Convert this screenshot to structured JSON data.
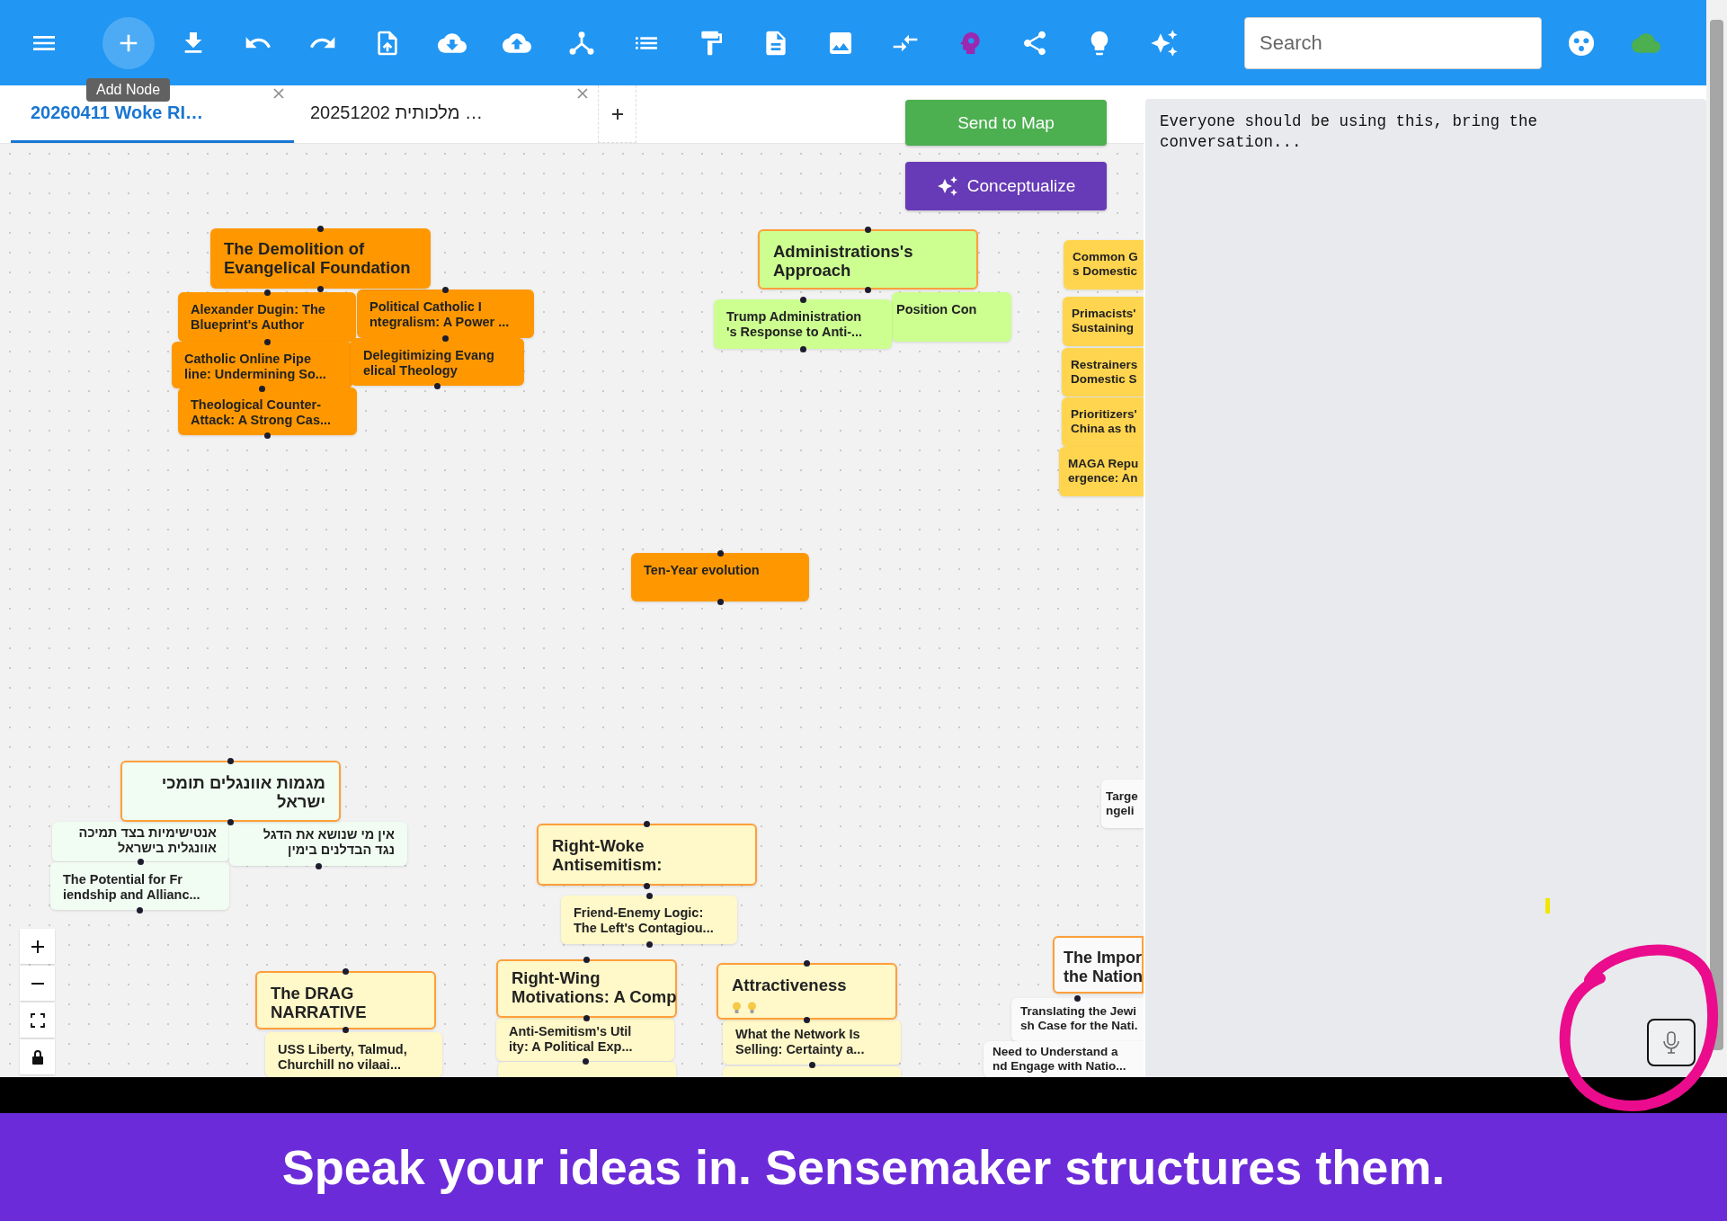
{
  "toolbar": {
    "tooltip": "Add Node",
    "search": {
      "placeholder": "Search"
    }
  },
  "tabs": [
    {
      "label": "20260411 Woke RI…",
      "selected": true
    },
    {
      "label": "20251202 מלכותית …",
      "selected": false
    }
  ],
  "actions": [
    {
      "label": "Send to Map",
      "kind": "send"
    },
    {
      "label": "Conceptualize",
      "kind": "conceptualize"
    }
  ],
  "nodes": [
    {
      "label": "The Demolition of\nEvangelical Foundation",
      "kind": "heading",
      "color": "#ff9800",
      "outlined": false
    },
    {
      "label": "Alexander Dugin: The\nBlueprint's Author",
      "kind": "item",
      "color": "#ff9800",
      "outlined": false
    },
    {
      "label": "Political Catholic I\nntegralism: A Power ...",
      "kind": "item",
      "color": "#ff9800",
      "outlined": false
    },
    {
      "label": "Catholic Online Pipe\nline: Undermining So...",
      "kind": "item",
      "color": "#ff9800",
      "outlined": false
    },
    {
      "label": "Delegitimizing Evang\nelical Theology",
      "kind": "item",
      "color": "#ff9800",
      "outlined": false
    },
    {
      "label": "Theological Counter-\nAttack: A Strong Cas...",
      "kind": "item",
      "color": "#ff9800",
      "outlined": false
    },
    {
      "label": "Administrations's\nApproach",
      "kind": "heading",
      "color": "#ccff90",
      "outlined": true
    },
    {
      "label": "Trump Administration\n's Response to Anti-...",
      "kind": "item",
      "color": "#ccff90",
      "outlined": false
    },
    {
      "label": "Position Con",
      "kind": "item",
      "color": "#ccff90",
      "outlined": false
    },
    {
      "label": "Common G\ns Domestic",
      "kind": "item",
      "color": "#ffd54f",
      "outlined": false
    },
    {
      "label": "Primacists'\nSustaining",
      "kind": "item",
      "color": "#ffd54f",
      "outlined": false
    },
    {
      "label": "Restrainers\nDomestic S",
      "kind": "item",
      "color": "#ffd54f",
      "outlined": false
    },
    {
      "label": "Prioritizers'\nChina as th",
      "kind": "item",
      "color": "#ffd54f",
      "outlined": false
    },
    {
      "label": "MAGA Repu\nergence: An",
      "kind": "item",
      "color": "#ffd54f",
      "outlined": false
    },
    {
      "label": "Ten-Year evolution",
      "kind": "item",
      "color": "#ff9800",
      "outlined": false
    },
    {
      "label": "מגמות אוונגלים תומכי\nישראל",
      "kind": "heading",
      "color": "#f1fcf3",
      "outlined": true,
      "rtl": true
    },
    {
      "label": "אנטישימיות בצד תמיכה\nאוונגלית בישראל",
      "kind": "item",
      "color": "#f1fcf3",
      "outlined": false,
      "rtl": true
    },
    {
      "label": "אין מי שנושא את הדגל\nנגד הבדלנים בימין",
      "kind": "item",
      "color": "#f1fcf3",
      "outlined": false,
      "rtl": true
    },
    {
      "label": "The Potential for Fr\niendship and Allianc...",
      "kind": "item",
      "color": "#f1fcf3",
      "outlined": false
    },
    {
      "label": "Right-Woke\nAntisemitism:",
      "kind": "heading",
      "color": "#fff8c8",
      "outlined": true
    },
    {
      "label": "Friend-Enemy Logic:\nThe Left's Contagiou...",
      "kind": "item",
      "color": "#fff8c8",
      "outlined": false
    },
    {
      "label": "The DRAG\nNARRATIVE",
      "kind": "heading",
      "color": "#fff8c8",
      "outlined": true
    },
    {
      "label": "USS Liberty, Talmud,\nChurchill no vilaai...",
      "kind": "item",
      "color": "#fff8c8",
      "outlined": false
    },
    {
      "label": "Right-Wing\nMotivations: A Comp",
      "kind": "heading",
      "color": "#fff8c8",
      "outlined": true
    },
    {
      "label": "Anti-Semitism's Util\nity: A Political Exp...",
      "kind": "item",
      "color": "#fff8c8",
      "outlined": false
    },
    {
      "kind": "item",
      "color": "#fff8c8",
      "outlined": false
    },
    {
      "label": "Attractiveness",
      "kind": "heading",
      "color": "#fff8c8",
      "outlined": true,
      "has_ideas": true
    },
    {
      "label": "What the Network Is\nSelling: Certainty a...",
      "kind": "item",
      "color": "#fff8c8",
      "outlined": false
    },
    {
      "kind": "item",
      "color": "#fff8c8",
      "outlined": false
    },
    {
      "label": "Targe\nngeli",
      "kind": "item",
      "color": "#fafafa",
      "outlined": false
    },
    {
      "label": "The Impor\nthe Nation",
      "kind": "heading",
      "color": "#fafafa",
      "outlined": true
    },
    {
      "label": "Translating the Jewi\nsh Case for the Nati.",
      "kind": "item",
      "color": "#fafafa",
      "outlined": false
    },
    {
      "label": "Need to Understand a\nnd Engage with Natio...",
      "kind": "item",
      "color": "#fafafa",
      "outlined": false
    }
  ],
  "chat_panel": {
    "message": "Everyone should be using this, bring the conversation..."
  },
  "banner": "Speak your ideas in. Sensemaker structures them."
}
